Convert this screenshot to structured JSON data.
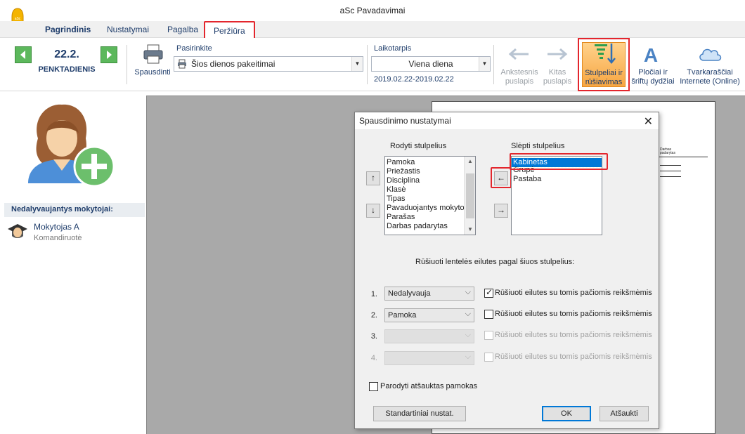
{
  "window": {
    "title": "aSc Pavadavimai"
  },
  "menu": [
    {
      "label": "Pagrindinis",
      "bold": true
    },
    {
      "label": "Nustatymai"
    },
    {
      "label": "Pagalba"
    },
    {
      "label": "Peržiūra",
      "active": true
    }
  ],
  "ribbon": {
    "date": "22.2.",
    "day": "PENKTADIENIS",
    "print_label": "Spausdinti",
    "select_label": "Pasirinkite",
    "select_value": "Šios dienos pakeitimai",
    "period_label": "Laikotarpis",
    "period_value": "Viena diena",
    "period_range": "2019.02.22-2019.02.22",
    "prev_page": "Ankstesnis puslapis",
    "next_page": "Kitas puslapis",
    "columns_sort": "Stulpeliai ir rūšiavimas",
    "widths_fonts": "Pločiai ir šriftų dydžiai",
    "online": "Tvarkaraščiai Internete (Online)"
  },
  "sidebar": {
    "header": "Nedalyvaujantys mokytojai:",
    "teacher_name": "Mokytojas A",
    "teacher_status": "Komandiruotė"
  },
  "preview": {
    "column_header": "Darbas padarytas"
  },
  "dialog": {
    "title": "Spausdinimo nustatymai",
    "show_label": "Rodyti stulpelius",
    "hide_label": "Slėpti stulpelius",
    "shown_columns": [
      "Pamoka",
      "Priežastis",
      "Disciplina",
      "Klasė",
      "Tipas",
      "Pavaduojantys mokytojai",
      "Parašas",
      "Darbas padarytas"
    ],
    "hidden_columns": [
      "Kabinetas",
      "Grupė",
      "Pastaba"
    ],
    "sort_label": "Rūšiuoti lentelės eilutes pagal šiuos stulpelius:",
    "sort_rows": [
      {
        "num": "1.",
        "value": "Nedalyvauja",
        "checked": true,
        "enabled": true
      },
      {
        "num": "2.",
        "value": "Pamoka",
        "checked": false,
        "enabled": true
      },
      {
        "num": "3.",
        "value": "",
        "checked": false,
        "enabled": false
      },
      {
        "num": "4.",
        "value": "",
        "checked": false,
        "enabled": false
      }
    ],
    "sort_check_label": "Rūšiuoti eilutes su tomis pačiomis reikšmėmis",
    "show_cancelled": "Parodyti atšauktas pamokas",
    "defaults_button": "Standartiniai nustat.",
    "ok_button": "OK",
    "cancel_button": "Atšaukti"
  },
  "colors": {
    "accent_red": "#e3262d",
    "nav_green": "#5cb85c",
    "selection_blue": "#0078d7",
    "ribbon_text": "#1f3d6b",
    "active_orange": "#f7a642"
  }
}
